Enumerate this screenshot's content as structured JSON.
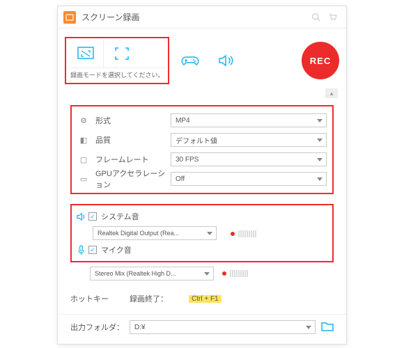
{
  "title": "スクリーン録画",
  "mode_hint": "録画モードを選択してください。",
  "rec_label": "REC",
  "settings": {
    "format": {
      "label": "形式",
      "value": "MP4"
    },
    "quality": {
      "label": "品質",
      "value": "デフォルト値"
    },
    "fps": {
      "label": "フレームレート",
      "value": "30 FPS"
    },
    "gpu": {
      "label": "GPUアクセラレーション",
      "value": "Off"
    }
  },
  "audio": {
    "system": {
      "label": "システム音",
      "device": "Realtek Digital Output (Rea..."
    },
    "mic": {
      "label": "マイク音",
      "device": "Stereo Mix (Realtek High D..."
    }
  },
  "hotkey": {
    "label": "ホットキー",
    "stop_label": "録画終了：",
    "stop_key": "Ctrl + F1"
  },
  "output": {
    "label": "出力フォルダ：",
    "path": "D:¥"
  }
}
